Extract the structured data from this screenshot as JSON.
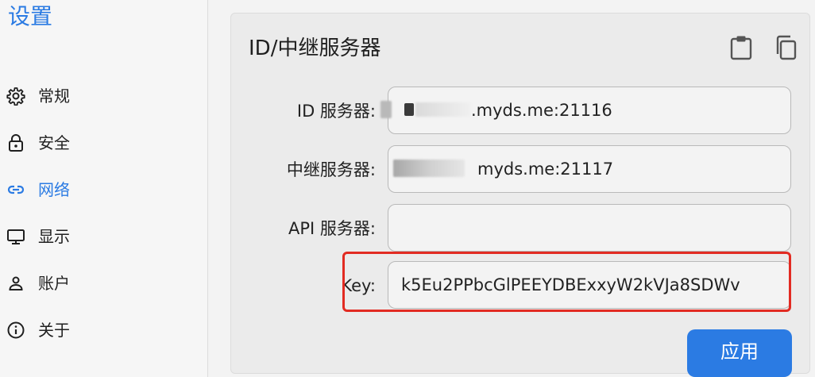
{
  "sidebar": {
    "title": "设置",
    "items": [
      {
        "label": "常规",
        "icon": "gear-icon"
      },
      {
        "label": "安全",
        "icon": "lock-icon"
      },
      {
        "label": "网络",
        "icon": "link-icon",
        "active": true
      },
      {
        "label": "显示",
        "icon": "monitor-icon"
      },
      {
        "label": "账户",
        "icon": "person-icon"
      },
      {
        "label": "关于",
        "icon": "info-icon"
      }
    ]
  },
  "card": {
    "title": "ID/中继服务器",
    "icons": [
      "clipboard-icon",
      "copy-icon"
    ]
  },
  "fields": {
    "id_server": {
      "label": "ID 服务器:",
      "value": ".myds.me:21116"
    },
    "relay_server": {
      "label": "中继服务器:",
      "value": "myds.me:21117"
    },
    "api_server": {
      "label": "API 服务器:",
      "value": ""
    },
    "key": {
      "label": "Key:",
      "value": "k5Eu2PPbcGlPEEYDBExxyW2kVJa8SDWv"
    }
  },
  "apply_button": {
    "label": "应用"
  },
  "colors": {
    "accent": "#2b7be3",
    "highlight": "#e22b22"
  }
}
